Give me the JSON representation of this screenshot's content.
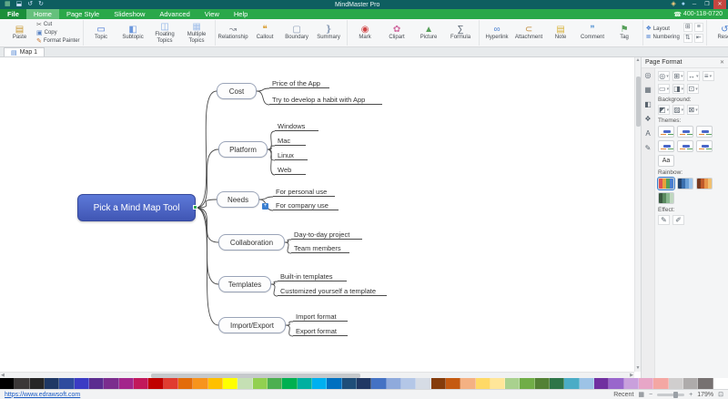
{
  "titlebar": {
    "title": "MindMaster Pro",
    "left_icons": [
      {
        "name": "app-logo-icon",
        "glyph": "▦",
        "color": "#8fd19e"
      },
      {
        "name": "save-icon",
        "glyph": "⬓",
        "color": "#cfe3ff"
      },
      {
        "name": "undo-icon",
        "glyph": "↺",
        "color": "#cfe3ff"
      },
      {
        "name": "redo-icon",
        "glyph": "↻",
        "color": "#cfe3ff"
      }
    ],
    "right_icons": [
      {
        "name": "share-icon",
        "glyph": "◈",
        "color": "#ffd27f"
      },
      {
        "name": "account-icon",
        "glyph": "●",
        "color": "#9fd4ff"
      }
    ],
    "window_buttons": [
      {
        "name": "minimize-button",
        "glyph": "─"
      },
      {
        "name": "maximize-button",
        "glyph": "❐"
      },
      {
        "name": "close-button",
        "glyph": "✕"
      }
    ]
  },
  "menubar": {
    "tabs": [
      "File",
      "Home",
      "Page Style",
      "Slideshow",
      "Advanced",
      "View",
      "Help"
    ],
    "active_tab": "Home",
    "hotline_icon": "☎",
    "hotline": "400-118-0720"
  },
  "ribbon": {
    "groups": [
      {
        "big": [
          {
            "name": "paste-button",
            "icon": "paste-icon",
            "glyph": "▤",
            "color": "#c9962e",
            "label": "Paste"
          }
        ],
        "small": [
          {
            "name": "cut-button",
            "icon": "cut-icon",
            "glyph": "✂",
            "color": "#6b6b6b",
            "label": "Cut"
          },
          {
            "name": "copy-button",
            "icon": "copy-icon",
            "glyph": "▣",
            "color": "#5b84c4",
            "label": "Copy"
          },
          {
            "name": "format-painter-button",
            "icon": "format-painter-icon",
            "glyph": "✎",
            "color": "#c9742e",
            "label": "Format Painter"
          }
        ]
      },
      {
        "big": [
          {
            "name": "topic-button",
            "icon": "topic-icon",
            "glyph": "▭",
            "color": "#3f6fd0",
            "label": "Topic"
          },
          {
            "name": "subtopic-button",
            "icon": "subtopic-icon",
            "glyph": "◧",
            "color": "#6d98dd",
            "label": "Subtopic"
          },
          {
            "name": "floating-topics-button",
            "icon": "floating-topics-icon",
            "glyph": "◫",
            "color": "#86aee6",
            "label": "Floating Topics"
          },
          {
            "name": "multiple-topics-button",
            "icon": "multiple-topics-icon",
            "glyph": "▦",
            "color": "#a3c0ea",
            "label": "Multiple Topics"
          }
        ]
      },
      {
        "big": [
          {
            "name": "relationship-button",
            "icon": "relationship-icon",
            "glyph": "↝",
            "color": "#8a8f98",
            "label": "Relationship"
          },
          {
            "name": "callout-button",
            "icon": "callout-icon",
            "glyph": "❝",
            "color": "#d89b2c",
            "label": "Callout"
          },
          {
            "name": "boundary-button",
            "icon": "boundary-icon",
            "glyph": "▢",
            "color": "#8a9bb5",
            "label": "Boundary"
          },
          {
            "name": "summary-button",
            "icon": "summary-icon",
            "glyph": "❵",
            "color": "#8a9bb5",
            "label": "Summary"
          }
        ]
      },
      {
        "big": [
          {
            "name": "mark-button",
            "icon": "mark-icon",
            "glyph": "◉",
            "color": "#d04545",
            "label": "Mark"
          },
          {
            "name": "clipart-button",
            "icon": "clipart-icon",
            "glyph": "✿",
            "color": "#d06ba0",
            "label": "Clipart"
          },
          {
            "name": "picture-button",
            "icon": "picture-icon",
            "glyph": "▲",
            "color": "#57a05a",
            "label": "Picture"
          },
          {
            "name": "formula-button",
            "icon": "formula-icon",
            "glyph": "∑",
            "color": "#55606e",
            "label": "Formula"
          }
        ]
      },
      {
        "big": [
          {
            "name": "hyperlink-button",
            "icon": "hyperlink-icon",
            "glyph": "∞",
            "color": "#4a7fd0",
            "label": "Hyperlink"
          },
          {
            "name": "attachment-button",
            "icon": "attachment-icon",
            "glyph": "⊂",
            "color": "#c08a3a",
            "label": "Attachment"
          },
          {
            "name": "note-button",
            "icon": "note-icon",
            "glyph": "▤",
            "color": "#d8b23a",
            "label": "Note"
          },
          {
            "name": "comment-button",
            "icon": "comment-icon",
            "glyph": "❞",
            "color": "#6aa0d8",
            "label": "Comment"
          },
          {
            "name": "tag-button",
            "icon": "tag-icon",
            "glyph": "⚑",
            "color": "#57a05a",
            "label": "Tag"
          }
        ]
      },
      {
        "rows": [
          {
            "name": "layout-button",
            "icon": "layout-icon",
            "glyph": "❖",
            "color": "#4a7fd0",
            "label": "Layout"
          },
          {
            "name": "numbering-button",
            "icon": "numbering-icon",
            "glyph": "≣",
            "color": "#4a7fd0",
            "label": "Numbering"
          }
        ],
        "minis": [
          {
            "name": "align-icon",
            "glyph": "⊞"
          },
          {
            "name": "list-icon",
            "glyph": "≡"
          },
          {
            "name": "spacing-icon",
            "glyph": "⇅"
          },
          {
            "name": "indent-icon",
            "glyph": "⇤"
          }
        ]
      },
      {
        "big": [
          {
            "name": "reset-button",
            "icon": "reset-icon",
            "glyph": "↺",
            "color": "#4a7fd0",
            "label": "Reset"
          }
        ]
      }
    ]
  },
  "document_tab": {
    "icon": "▤",
    "label": "Map 1"
  },
  "mindmap": {
    "root": "Pick a Mind Map Tool",
    "branches": [
      {
        "label": "Cost",
        "children": [
          "Price of the App",
          "Try to develop a habit with App"
        ]
      },
      {
        "label": "Platform",
        "children": [
          "Windows",
          "Mac",
          "Linux",
          "Web"
        ]
      },
      {
        "label": "Needs",
        "children": [
          "For personal use",
          "For company use"
        ]
      },
      {
        "label": "Collaboration",
        "children": [
          "Day-to-day project",
          "Team members"
        ]
      },
      {
        "label": "Templates",
        "children": [
          "Built-in templates",
          "Customized yourself a template"
        ]
      },
      {
        "label": "Import/Export",
        "children": [
          "Import format",
          "Export format"
        ]
      }
    ]
  },
  "panel": {
    "title": "Page Format",
    "close_glyph": "✕",
    "strip_icons": [
      {
        "name": "zoom-tool-icon",
        "glyph": "◎"
      },
      {
        "name": "page-tool-icon",
        "glyph": "▦"
      },
      {
        "name": "background-tool-icon",
        "glyph": "◧"
      },
      {
        "name": "theme-tool-icon",
        "glyph": "❖"
      },
      {
        "name": "text-tool-icon",
        "glyph": "A"
      },
      {
        "name": "pen-tool-icon",
        "glyph": "✎"
      }
    ],
    "toolbar_rows": [
      [
        {
          "name": "zoom-icon",
          "glyph": "◎"
        },
        {
          "name": "layout-style-icon",
          "glyph": "⊞"
        },
        {
          "name": "connector-style-icon",
          "glyph": "↔"
        },
        {
          "name": "distance-icon",
          "glyph": "≡"
        }
      ],
      [
        {
          "name": "page-size-icon",
          "glyph": "▭"
        },
        {
          "name": "orientation-icon",
          "glyph": "◨"
        },
        {
          "name": "margin-icon",
          "glyph": "⊡"
        }
      ]
    ],
    "sections": {
      "background": {
        "label": "Background:",
        "icons": [
          {
            "name": "bg-color-icon",
            "glyph": "◩"
          },
          {
            "name": "bg-image-icon",
            "glyph": "▨"
          },
          {
            "name": "bg-remove-icon",
            "glyph": "⊠"
          }
        ]
      },
      "themes": {
        "label": "Themes:",
        "thumb_count": 6,
        "font_button": "Aa"
      },
      "rainbow": {
        "label": "Rainbow:",
        "thumb_count": 4
      },
      "effect": {
        "label": "Effect:",
        "icons": [
          {
            "name": "hand-drawn-icon",
            "glyph": "✎"
          },
          {
            "name": "pen-style-icon",
            "glyph": "✐"
          }
        ]
      }
    }
  },
  "palette_colors": [
    "#000000",
    "#3b3838",
    "#262626",
    "#1f3864",
    "#2e4b9e",
    "#3b3bc4",
    "#5b2d90",
    "#7b2d8e",
    "#a3258c",
    "#c2185b",
    "#c00000",
    "#e03c31",
    "#e36c0a",
    "#f7941d",
    "#ffc000",
    "#ffff00",
    "#c5e0b4",
    "#92d050",
    "#4caf50",
    "#00b050",
    "#00b0a0",
    "#00b0f0",
    "#0070c0",
    "#1f4e79",
    "#203864",
    "#4472c4",
    "#8faadc",
    "#b4c7e7",
    "#d6dce5",
    "#843c0c",
    "#c55a11",
    "#f4b183",
    "#ffd966",
    "#ffe699",
    "#a9d18e",
    "#70ad47",
    "#538135",
    "#2e7548",
    "#4bacc6",
    "#9dc3e6",
    "#7030a0",
    "#9966cc",
    "#c9a0dc",
    "#e7a6c7",
    "#f4a7a3",
    "#d0cece",
    "#aeabab",
    "#767171",
    "#ffffff"
  ],
  "statusbar": {
    "url": "https://www.edrawsoft.com",
    "recent": "Recent",
    "pages_icon": "▦",
    "fit_icon": "⊡",
    "zoom_out": "−",
    "zoom_in": "+",
    "zoom_percent": "179%"
  }
}
